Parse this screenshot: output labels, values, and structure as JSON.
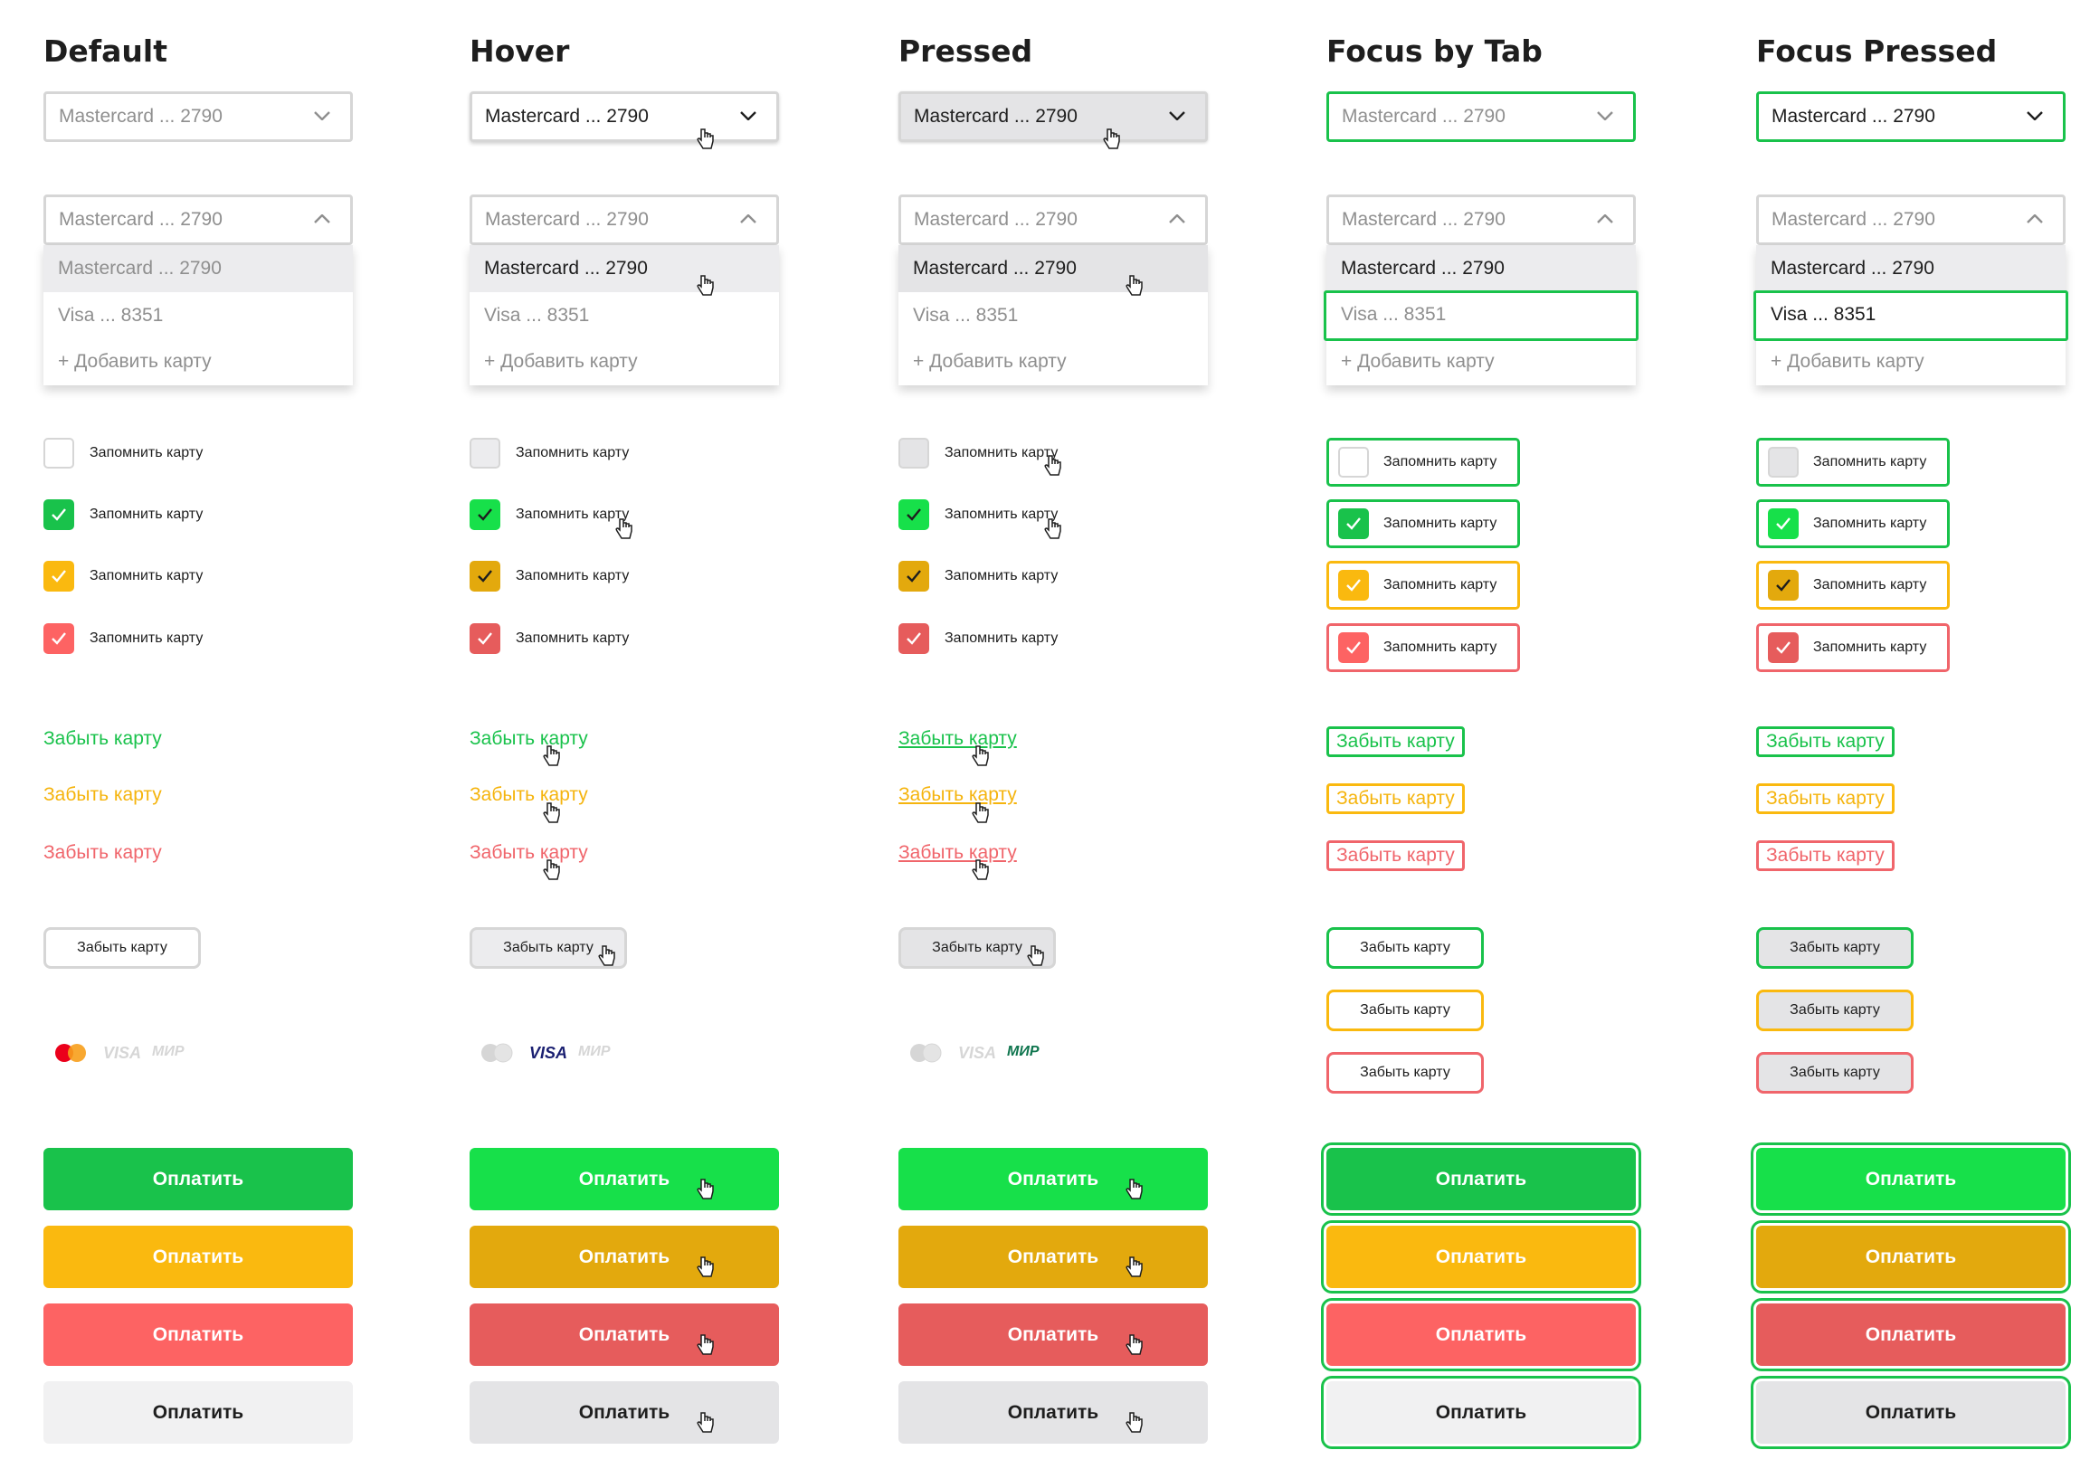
{
  "colors": {
    "green": "#19c24b",
    "green_light": "#17e04a",
    "yellow": "#fab90f",
    "yellow_dark": "#e3a90d",
    "red": "#fd6363",
    "red_dark": "#e65c5c",
    "gray_btn": "#f1f1f2",
    "gray_btn_dark": "#e4e4e6"
  },
  "columns": [
    {
      "heading": "Default"
    },
    {
      "heading": "Hover"
    },
    {
      "heading": "Pressed"
    },
    {
      "heading": "Focus by Tab"
    },
    {
      "heading": "Focus Pressed"
    }
  ],
  "select": {
    "value": "Mastercard ... 2790",
    "chevron_down": "chevron-down-icon",
    "chevron_up": "chevron-up-icon"
  },
  "menu": {
    "options": [
      "Mastercard ... 2790",
      "Visa ... 8351",
      "+ Добавить карту"
    ]
  },
  "checkbox": {
    "label": "Запомнить карту",
    "variants": [
      "unchecked",
      "green",
      "yellow",
      "red"
    ]
  },
  "link": {
    "label": "Забыть карту"
  },
  "outline_button": {
    "label": "Забыть карту"
  },
  "logos": {
    "visa": "VISA",
    "mir": "МИР"
  },
  "pay_button": {
    "label": "Оплатить"
  }
}
